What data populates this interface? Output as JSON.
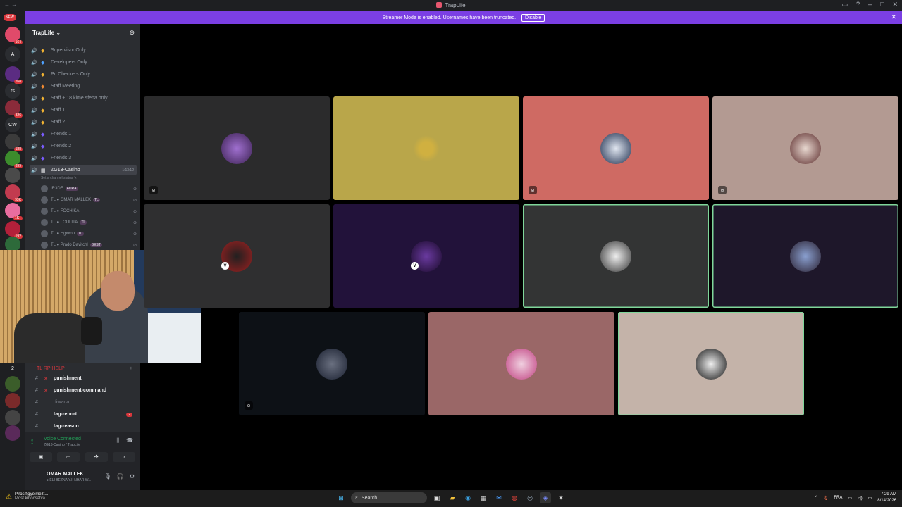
{
  "window": {
    "title": "TrapLife",
    "nav": "← →"
  },
  "banner": {
    "message": "Streamer Mode is enabled. Usernames have been truncated.",
    "disable_label": "Disable",
    "close_icon": "✕"
  },
  "servers": [
    {
      "label": "",
      "badge": "164",
      "color": "#e04a6a"
    },
    {
      "label": "A",
      "badge": "",
      "color": "#2b2d31"
    },
    {
      "label": "",
      "badge": "268",
      "color": "#5b2c82"
    },
    {
      "label": "rs",
      "badge": "",
      "color": "#2b2d31"
    },
    {
      "label": "",
      "badge": "326",
      "color": "#8a2b3a"
    },
    {
      "label": "CW",
      "badge": "",
      "color": "#2b2d31"
    },
    {
      "label": "",
      "badge": "188",
      "color": "#3b3b3b"
    },
    {
      "label": "",
      "badge": "899",
      "color": "#3c8c2c"
    },
    {
      "label": "",
      "badge": "",
      "color": "#4a4a4a"
    },
    {
      "label": "",
      "badge": "93K",
      "color": "#c23b4f"
    },
    {
      "label": "",
      "badge": "1K+",
      "color": "#e96d9f"
    },
    {
      "label": "",
      "badge": "192",
      "color": "#b3203a"
    },
    {
      "label": "",
      "badge": "",
      "color": "#2d6a3a"
    }
  ],
  "servers_new": "NEW",
  "guild": {
    "name": "TrapLife ⌄",
    "add_user_icon": "⊕"
  },
  "voice_channels": [
    {
      "name": "Supervisor Only",
      "role_color": "#f0b232"
    },
    {
      "name": "Developers Only",
      "role_color": "#4ea1ff"
    },
    {
      "name": "Pc Checkers Only",
      "role_color": "#f0b232"
    },
    {
      "name": "Staff Meeting",
      "role_color": "#f08a32"
    },
    {
      "name": "Staff + 18 klme sfeha only",
      "role_color": "#f0b232"
    },
    {
      "name": "Staff 1",
      "role_color": "#f0b232"
    },
    {
      "name": "Staff 2",
      "role_color": "#f0b232"
    },
    {
      "name": "Friends 1",
      "role_color": "#7a5cff"
    },
    {
      "name": "Friends 2",
      "role_color": "#7a5cff"
    },
    {
      "name": "Friends 3",
      "role_color": "#7a5cff"
    }
  ],
  "active_channel": {
    "name": "ZG13-Casino",
    "time": "1:13:12",
    "status": "Set a channel status ✎"
  },
  "members": [
    {
      "name": "IR3DE",
      "tag": "AURA"
    },
    {
      "name": "TL ● OMAR MALLEK",
      "tag": "TL"
    },
    {
      "name": "TL ● FOCHIKA",
      "tag": ""
    },
    {
      "name": "TL ● LOULITA",
      "tag": "TL"
    },
    {
      "name": "TL ● Hgxxop",
      "tag": "TL"
    },
    {
      "name": "TL ● Prado Davitchl",
      "tag": "BEST"
    }
  ],
  "text_section": {
    "label": "TL RP HELP",
    "count": "2"
  },
  "text_channels": [
    {
      "name": "punishment",
      "mark": "✕",
      "mention": "",
      "muted": false
    },
    {
      "name": "punishment-command",
      "mark": "✕",
      "mention": "",
      "muted": false
    },
    {
      "name": "diwana",
      "mark": "",
      "mention": "",
      "muted": true
    },
    {
      "name": "tag-report",
      "mark": "",
      "mention": "2",
      "muted": false
    },
    {
      "name": "tag-reason",
      "mark": "",
      "mention": "",
      "muted": false
    }
  ],
  "voice_panel": {
    "status": "Voice Connected",
    "sub": "ZG13-Casino / TrapLife"
  },
  "user": {
    "name": "OMAR MALLEK",
    "sub": "● ELI BEZNA Y.II NHAR W..."
  },
  "taskbar": {
    "weather_title": "Piros figyelmezt...",
    "weather_sub": "Most kibocsátva",
    "search_label": "Search",
    "lang": "FRA",
    "time": "7:29 AM",
    "date": "8/14/2026"
  },
  "colors": {
    "accent": "#7b3fe4",
    "voice_connected": "#23a55a",
    "speaking_border": "#7fd69a"
  }
}
